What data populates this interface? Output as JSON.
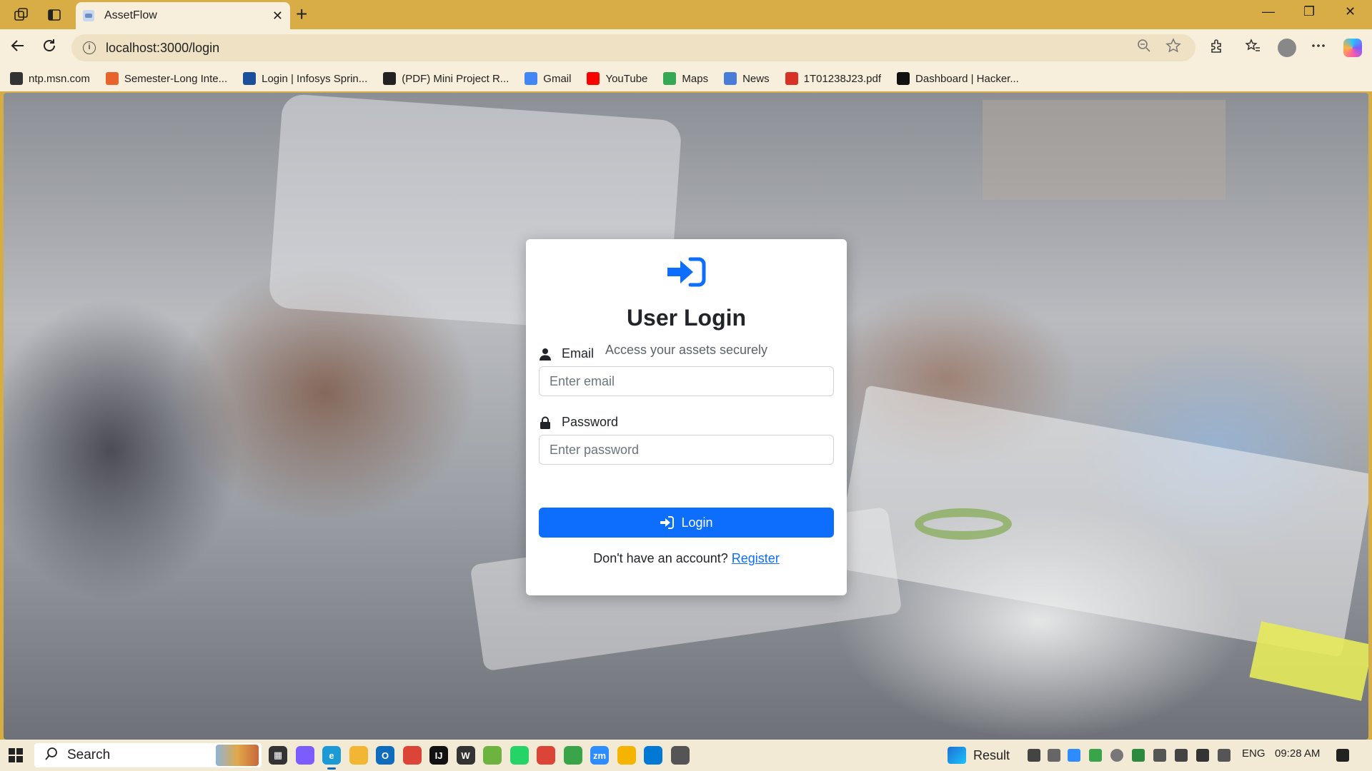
{
  "browser": {
    "tab": {
      "title": "AssetFlow",
      "close": "✕"
    },
    "new_tab": "+",
    "window_controls": {
      "minimize": "—",
      "restore": "❐",
      "close": "✕"
    },
    "address": {
      "url": "localhost:3000/login"
    },
    "bookmarks": [
      {
        "label": "ntp.msn.com",
        "icon": "globe-icon",
        "color": "#333333"
      },
      {
        "label": "Semester-Long Inte...",
        "icon": "bookmark-icon",
        "color": "#e8632b"
      },
      {
        "label": "Login | Infosys Sprin...",
        "icon": "infosys-icon",
        "color": "#1b4f9c"
      },
      {
        "label": "(PDF) Mini Project R...",
        "icon": "academia-icon",
        "color": "#222222"
      },
      {
        "label": "Gmail",
        "icon": "google-icon",
        "color": "#4285f4"
      },
      {
        "label": "YouTube",
        "icon": "youtube-icon",
        "color": "#ff0000"
      },
      {
        "label": "Maps",
        "icon": "maps-icon",
        "color": "#34a853"
      },
      {
        "label": "News",
        "icon": "news-icon",
        "color": "#4a7bd6"
      },
      {
        "label": "1T01238J23.pdf",
        "icon": "pdf-icon",
        "color": "#d93025"
      },
      {
        "label": "Dashboard | Hacker...",
        "icon": "hackerrank-icon",
        "color": "#111111"
      }
    ]
  },
  "login": {
    "title": "User Login",
    "subtitle": "Access your assets securely",
    "email_label": "Email",
    "email_placeholder": "Enter email",
    "email_value": "",
    "password_label": "Password",
    "password_placeholder": "Enter password",
    "password_value": "",
    "button_label": "Login",
    "register_prompt": "Don't have an account?",
    "register_link": "Register",
    "accent": "#0d6efd"
  },
  "taskbar": {
    "search_label": "Search",
    "result_label": "Result",
    "language": "ENG",
    "time": "09:28 AM",
    "apps": [
      {
        "name": "task-view-icon",
        "color": "#333333",
        "glyph": "▦"
      },
      {
        "name": "copilot-icon",
        "color": "#7d5cff",
        "glyph": ""
      },
      {
        "name": "edge-icon",
        "color": "#1b9ad6",
        "glyph": "e"
      },
      {
        "name": "file-explorer-icon",
        "color": "#f2b632",
        "glyph": ""
      },
      {
        "name": "outlook-icon",
        "color": "#0f6cbd",
        "glyph": "O"
      },
      {
        "name": "chrome-icon",
        "color": "#db4437",
        "glyph": ""
      },
      {
        "name": "intellij-icon",
        "color": "#111111",
        "glyph": "IJ"
      },
      {
        "name": "wordpress-icon",
        "color": "#333333",
        "glyph": "W"
      },
      {
        "name": "spring-icon",
        "color": "#6db33f",
        "glyph": ""
      },
      {
        "name": "whatsapp-icon",
        "color": "#25d366",
        "glyph": ""
      },
      {
        "name": "chrome-profile-icon",
        "color": "#db4437",
        "glyph": ""
      },
      {
        "name": "app-green-icon",
        "color": "#3aa44a",
        "glyph": ""
      },
      {
        "name": "zoom-icon",
        "color": "#2d8cff",
        "glyph": "zm"
      },
      {
        "name": "chrome-alt-icon",
        "color": "#f4b400",
        "glyph": ""
      },
      {
        "name": "vscode-icon",
        "color": "#0078d4",
        "glyph": ""
      },
      {
        "name": "settings-app-icon",
        "color": "#555555",
        "glyph": ""
      }
    ]
  }
}
